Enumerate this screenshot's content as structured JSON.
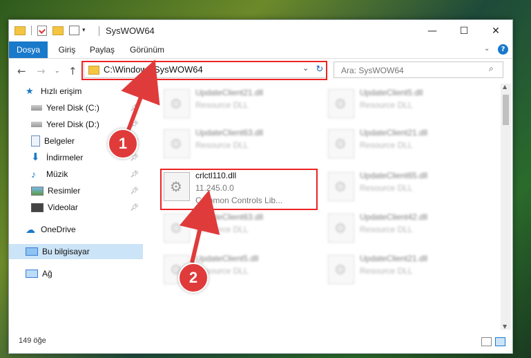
{
  "window": {
    "title": "SysWOW64",
    "controls": [
      "—",
      "☐",
      "✕"
    ]
  },
  "ribbon": {
    "tabs": [
      "Dosya",
      "Giriş",
      "Paylaş",
      "Görünüm"
    ]
  },
  "address": {
    "path": "C:\\Windows\\SysWOW64",
    "search_placeholder": "Ara: SysWOW64"
  },
  "sidebar": {
    "quick_access": "Hızlı erişim",
    "items": [
      {
        "label": "Yerel Disk (C:)",
        "icon": "drive-icon"
      },
      {
        "label": "Yerel Disk (D:)",
        "icon": "drive-icon"
      },
      {
        "label": "Belgeler",
        "icon": "documents-icon"
      },
      {
        "label": "İndirmeler",
        "icon": "download-icon"
      },
      {
        "label": "Müzik",
        "icon": "music-icon"
      },
      {
        "label": "Resimler",
        "icon": "pictures-icon"
      },
      {
        "label": "Videolar",
        "icon": "videos-icon"
      }
    ],
    "onedrive": "OneDrive",
    "this_pc": "Bu bilgisayar",
    "network": "Ağ"
  },
  "files": [
    {
      "name": "UpdateClient21.dll",
      "line2": "Resource DLL",
      "blurred": true
    },
    {
      "name": "UpdateClient5.dll",
      "line2": "Resource DLL",
      "blurred": true
    },
    {
      "name": "UpdateClient63.dll",
      "line2": "Resource DLL",
      "blurred": true
    },
    {
      "name": "UpdateClient21.dll",
      "line2": "Resource DLL",
      "blurred": true
    },
    {
      "name": "crlctl110.dll",
      "line2": "11.245.0.0",
      "line3": "Common Controls Lib...",
      "blurred": false
    },
    {
      "name": "UpdateClient65.dll",
      "line2": "Resource DLL",
      "blurred": true
    },
    {
      "name": "UpdateClient63.dll",
      "line2": "Resource DLL",
      "blurred": true
    },
    {
      "name": "UpdateClient42.dll",
      "line2": "Resource DLL",
      "blurred": true
    },
    {
      "name": "UpdateClient5.dll",
      "line2": "Resource DLL",
      "blurred": true
    },
    {
      "name": "UpdateClient21.dll",
      "line2": "Resource DLL",
      "blurred": true
    }
  ],
  "status": {
    "count": "149 öğe"
  },
  "annotations": {
    "badge1": "1",
    "badge2": "2",
    "color": "#e22222"
  }
}
